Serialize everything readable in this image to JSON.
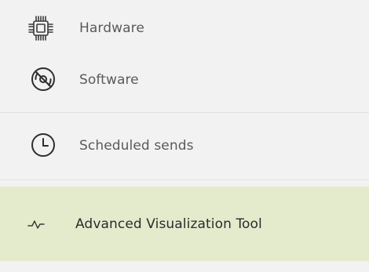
{
  "menu": {
    "items": [
      {
        "label": "Hardware",
        "icon": "chip-icon"
      },
      {
        "label": "Software",
        "icon": "disc-icon"
      },
      {
        "label": "Scheduled sends",
        "icon": "clock-icon"
      },
      {
        "label": "Advanced Visualization Tool",
        "icon": "pulse-icon",
        "active": true
      }
    ],
    "colors": {
      "background": "#f2f2f2",
      "active_background": "#e4ebcd",
      "text": "#5a5a5a",
      "active_text": "#2b2b2b",
      "divider": "#e2e2e2"
    }
  }
}
